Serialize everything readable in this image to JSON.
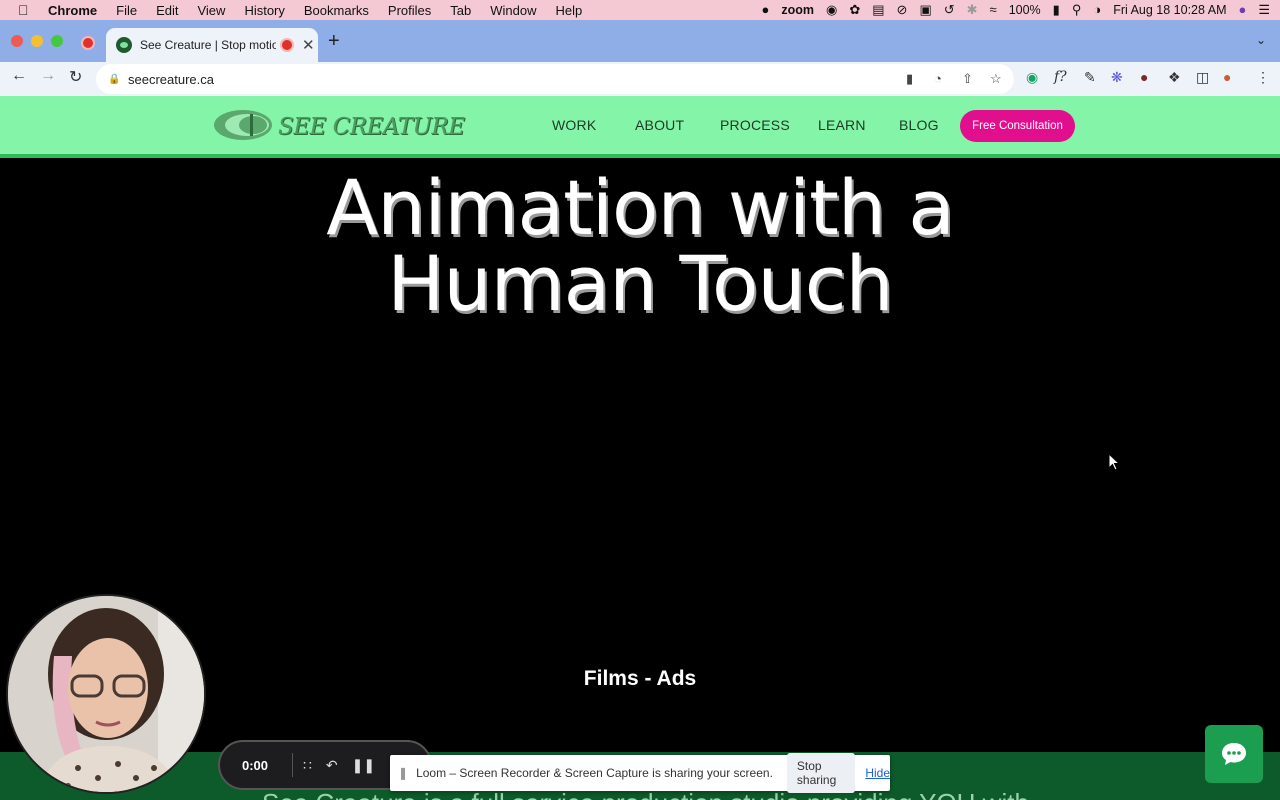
{
  "menubar": {
    "items": [
      "Chrome",
      "File",
      "Edit",
      "View",
      "History",
      "Bookmarks",
      "Profiles",
      "Tab",
      "Window",
      "Help"
    ],
    "zoom_label": "zoom",
    "battery": "100%",
    "datetime": "Fri Aug 18  10:28 AM"
  },
  "browser": {
    "tab_title": "See Creature | Stop motion",
    "url": "seecreature.ca"
  },
  "site": {
    "logo_text": "SEE CREATURE",
    "nav": [
      "WORK",
      "ABOUT",
      "PROCESS",
      "LEARN",
      "BLOG"
    ],
    "cta_label": "Free Consultation",
    "colors": {
      "header": "#84f5a8",
      "cta": "#e10e8e",
      "footer": "#0d5a2a"
    }
  },
  "hero": {
    "title_line1": "Animation with a",
    "title_line2": "Human Touch",
    "subtitle": "Films - Ads"
  },
  "footer": {
    "partial_text": "See Creature is a full service production studio providing YOU with"
  },
  "loom": {
    "time": "0:00",
    "share_message": "Loom – Screen Recorder & Screen Capture is sharing your screen.",
    "stop_label": "Stop sharing",
    "hide_label": "Hide"
  }
}
